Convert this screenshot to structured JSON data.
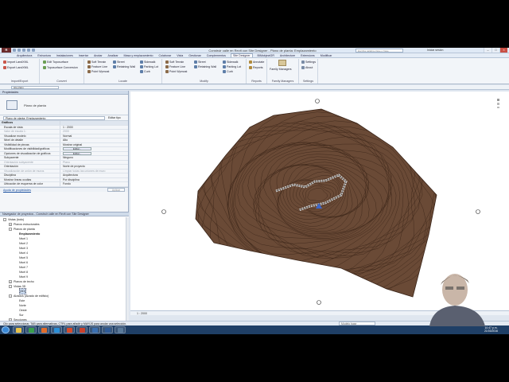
{
  "window": {
    "title": "Construir calle en Revit con Site Designer - Plano de planta: Emplazamiento",
    "search_placeholder": "Escriba palabra clave o frase",
    "login": "Iniciar sesión",
    "logo": "R"
  },
  "menu_tabs": [
    "Arquitectura",
    "Estructura",
    "Instalaciones",
    "Insertar",
    "Anotar",
    "Analizar",
    "Masa y emplazamiento",
    "Colaborar",
    "Vista",
    "Gestionar",
    "Complementos",
    "Site Designer",
    "BIMobjectGR",
    "Architecture",
    "Extensions",
    "Modificar"
  ],
  "menu_active": "Site Designer",
  "ribbon": {
    "groups": [
      {
        "label": "Import/Export",
        "items": [
          "Import LandXML",
          "Export LandXML"
        ]
      },
      {
        "label": "Convert",
        "items": [
          "Edit Toposurface",
          "Toposurface Conversion"
        ]
      },
      {
        "label": "Locate",
        "items": [
          "Soft Terrain",
          "Feature Line",
          "Point Wpmost",
          "Street",
          "Retaining Wall",
          "Sidewalk",
          "Parking Lot",
          "Curb"
        ]
      },
      {
        "label": "Modify",
        "items": [
          "Soft Terrain",
          "Feature Line",
          "Point Wpmost",
          "Street",
          "Retaining Wall",
          "Sidewalk",
          "Parking Lot",
          "Curb"
        ]
      },
      {
        "label": "Reports",
        "items": [
          "Annotate",
          "Reports"
        ]
      },
      {
        "label": "Family Managers",
        "items": [
          "Family Managers"
        ]
      },
      {
        "label": "Settings",
        "items": [
          "Settings",
          "About"
        ]
      }
    ]
  },
  "options_bar": {
    "select": "site plano"
  },
  "properties": {
    "header": "Propiedades",
    "type_name": "Plano de planta",
    "instance_select": "Plano de planta: Emplazamiento",
    "edit_type": "Editar tipo",
    "rows": [
      {
        "k": "Gráficos",
        "v": "",
        "section": true
      },
      {
        "k": "Escala de vista",
        "v": "1 : 2000"
      },
      {
        "k": "Valor de escala    1:",
        "v": "2000",
        "grey": true
      },
      {
        "k": "Visualizar modelo",
        "v": "Normal"
      },
      {
        "k": "Nivel de detalle",
        "v": "Alto"
      },
      {
        "k": "Visibilidad de piezas",
        "v": "Mostrar original"
      },
      {
        "k": "Modificaciones de visibilidad/gráficos",
        "v": "Editar...",
        "button": true
      },
      {
        "k": "Opciones de visualización de gráficos",
        "v": "Editar...",
        "button": true
      },
      {
        "k": "Subyacente",
        "v": "Ninguno"
      },
      {
        "k": "Orientación subyacente",
        "v": "Plano",
        "grey": true
      },
      {
        "k": "Orientación",
        "v": "Norte de proyecto"
      },
      {
        "k": "Visualización de unión de muros",
        "v": "Limpiar todas las uniones de muro",
        "grey": true
      },
      {
        "k": "Disciplina",
        "v": "Arquitectura"
      },
      {
        "k": "Mostrar líneas ocultas",
        "v": "Por disciplina"
      },
      {
        "k": "Ubicación de esquema de color",
        "v": "Fondo"
      }
    ],
    "help_link": "Ayuda de propiedades",
    "apply": "Aplicar"
  },
  "browser": {
    "header": "Navegador de proyectos - Construir calle en Revit con Site Designer",
    "nodes": [
      {
        "label": "Vistas (todo)",
        "depth": 0,
        "toggle": "-"
      },
      {
        "label": "Planos estructurales",
        "depth": 1,
        "toggle": "+"
      },
      {
        "label": "Planos de planta",
        "depth": 1,
        "toggle": "-"
      },
      {
        "label": "Emplazamiento",
        "depth": 2,
        "toggle": "",
        "bold": true
      },
      {
        "label": "Nivel 1",
        "depth": 2,
        "toggle": ""
      },
      {
        "label": "Nivel 2",
        "depth": 2,
        "toggle": ""
      },
      {
        "label": "Nivel 3",
        "depth": 2,
        "toggle": ""
      },
      {
        "label": "Nivel 4",
        "depth": 2,
        "toggle": ""
      },
      {
        "label": "Nivel 5",
        "depth": 2,
        "toggle": ""
      },
      {
        "label": "Nivel 6",
        "depth": 2,
        "toggle": ""
      },
      {
        "label": "Nivel 7",
        "depth": 2,
        "toggle": ""
      },
      {
        "label": "Nivel 8",
        "depth": 2,
        "toggle": ""
      },
      {
        "label": "Nivel 9",
        "depth": 2,
        "toggle": ""
      },
      {
        "label": "Planos de techo",
        "depth": 1,
        "toggle": "+"
      },
      {
        "label": "Vistas 3D",
        "depth": 1,
        "toggle": "-"
      },
      {
        "label": "{3D}",
        "depth": 2,
        "toggle": "",
        "selected": true
      },
      {
        "label": "Alzados (Alzado de edificio)",
        "depth": 1,
        "toggle": "-"
      },
      {
        "label": "Este",
        "depth": 2,
        "toggle": ""
      },
      {
        "label": "Norte",
        "depth": 2,
        "toggle": ""
      },
      {
        "label": "Oeste",
        "depth": 2,
        "toggle": ""
      },
      {
        "label": "Sur",
        "depth": 2,
        "toggle": ""
      },
      {
        "label": "Secciones",
        "depth": 1,
        "toggle": "+"
      }
    ]
  },
  "view": {
    "scale": "1 : 2000"
  },
  "status": {
    "message": "Clic para seleccionar, TAB para alternativas, CTRL para añadir y MAYÚS para anular una selección.",
    "model": "Modelo base"
  },
  "taskbar": {
    "time": "10:47 p.m.",
    "date": "21/03/2016",
    "apps": [
      "explorer-icon",
      "chrome-icon",
      "firefox-icon",
      "skype-icon",
      "office-icon",
      "powerpoint-icon",
      "revit-icon",
      "revit2-icon",
      "media-icon"
    ]
  },
  "colors": {
    "terrain": "#6a4a36",
    "contour": "#3a2418",
    "accent": "#3d66c7"
  }
}
